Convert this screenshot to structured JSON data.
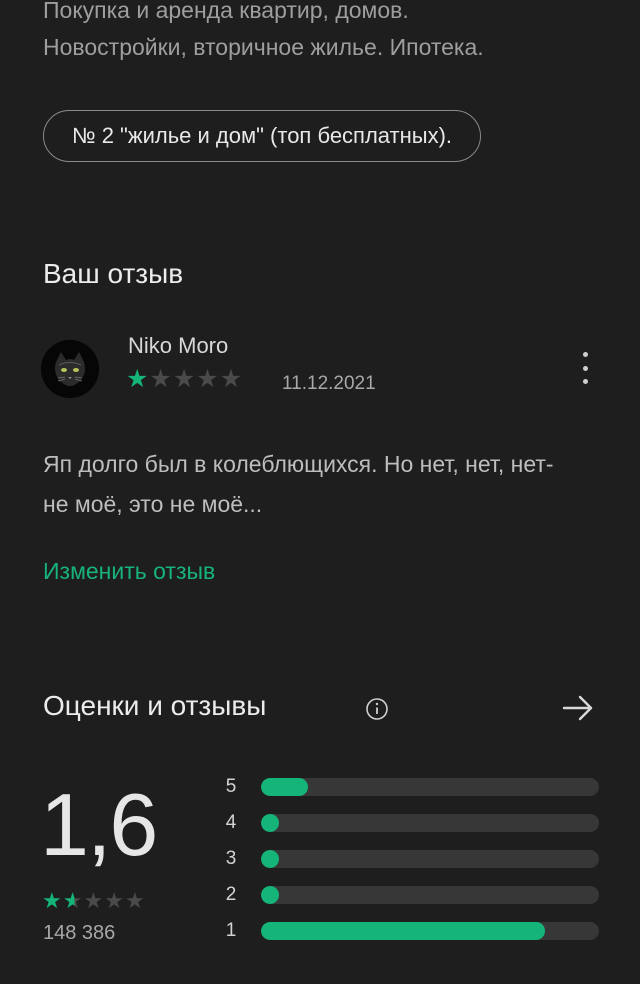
{
  "app": {
    "description_lines": [
      "Покупка и аренда квартир, домов.",
      "Новостройки, вторичное жилье. Ипотека."
    ],
    "rank_chip": "№ 2 \"жилье и дом\" (топ бесплатных)."
  },
  "your_review": {
    "title": "Ваш отзыв",
    "author": "Niko Moro",
    "rating": 1,
    "max_rating": 5,
    "date": "11.12.2021",
    "text": "Яп долго был в колеблющихся. Но нет, нет, нет- не моё, это не моё...",
    "edit_label": "Изменить отзыв",
    "more_icon": "more-vert-icon",
    "avatar_icon": "cat-avatar"
  },
  "ratings": {
    "title": "Оценки и отзывы",
    "info_icon": "info-icon",
    "arrow_icon": "arrow-right-icon",
    "average": "1,6",
    "average_value": 1.6,
    "count": "148 386",
    "distribution": [
      {
        "label": "5",
        "fraction": 0.14
      },
      {
        "label": "4",
        "fraction": 0.03
      },
      {
        "label": "3",
        "fraction": 0.03
      },
      {
        "label": "2",
        "fraction": 0.03
      },
      {
        "label": "1",
        "fraction": 0.84
      }
    ]
  },
  "colors": {
    "background": "#1e1e1e",
    "accent": "#15b478",
    "star_filled": "#15b478",
    "star_empty": "#4a4a4a",
    "bar_track": "#373737"
  }
}
